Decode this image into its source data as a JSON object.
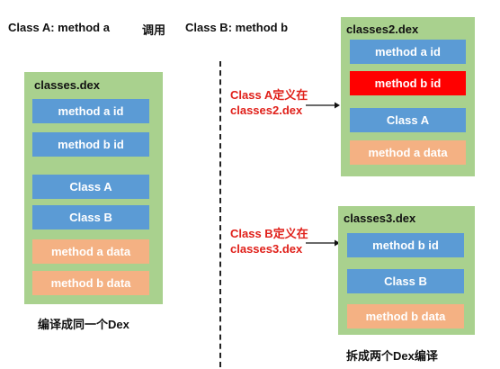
{
  "header": {
    "class_a": "Class A:  method a",
    "call": "调用",
    "class_b": "Class B: method b"
  },
  "left_panel": {
    "title": "classes.dex",
    "blocks": [
      {
        "label": "method a id",
        "color": "#5b9bd5"
      },
      {
        "label": "method b id",
        "color": "#5b9bd5"
      },
      {
        "label": "Class A",
        "color": "#5b9bd5"
      },
      {
        "label": "Class B",
        "color": "#5b9bd5"
      },
      {
        "label": "method a data",
        "color": "#f4b183"
      },
      {
        "label": "method b data",
        "color": "#f4b183"
      }
    ],
    "caption": "编译成同一个Dex"
  },
  "right_top_panel": {
    "title": "classes2.dex",
    "blocks": [
      {
        "label": "method a id",
        "color": "#5b9bd5"
      },
      {
        "label": "method b id",
        "color": "#ff0000"
      },
      {
        "label": "Class A",
        "color": "#5b9bd5"
      },
      {
        "label": "method a data",
        "color": "#f4b183"
      }
    ]
  },
  "right_bottom_panel": {
    "title": "classes3.dex",
    "blocks": [
      {
        "label": "method b id",
        "color": "#5b9bd5"
      },
      {
        "label": "Class B",
        "color": "#5b9bd5"
      },
      {
        "label": "method b data",
        "color": "#f4b183"
      }
    ]
  },
  "notes": {
    "class_a_line1": "Class A定义在",
    "class_a_line2": "classes2.dex",
    "class_b_line1": "Class B定义在",
    "class_b_line2": "classes3.dex"
  },
  "right_caption": "拆成两个Dex编译"
}
